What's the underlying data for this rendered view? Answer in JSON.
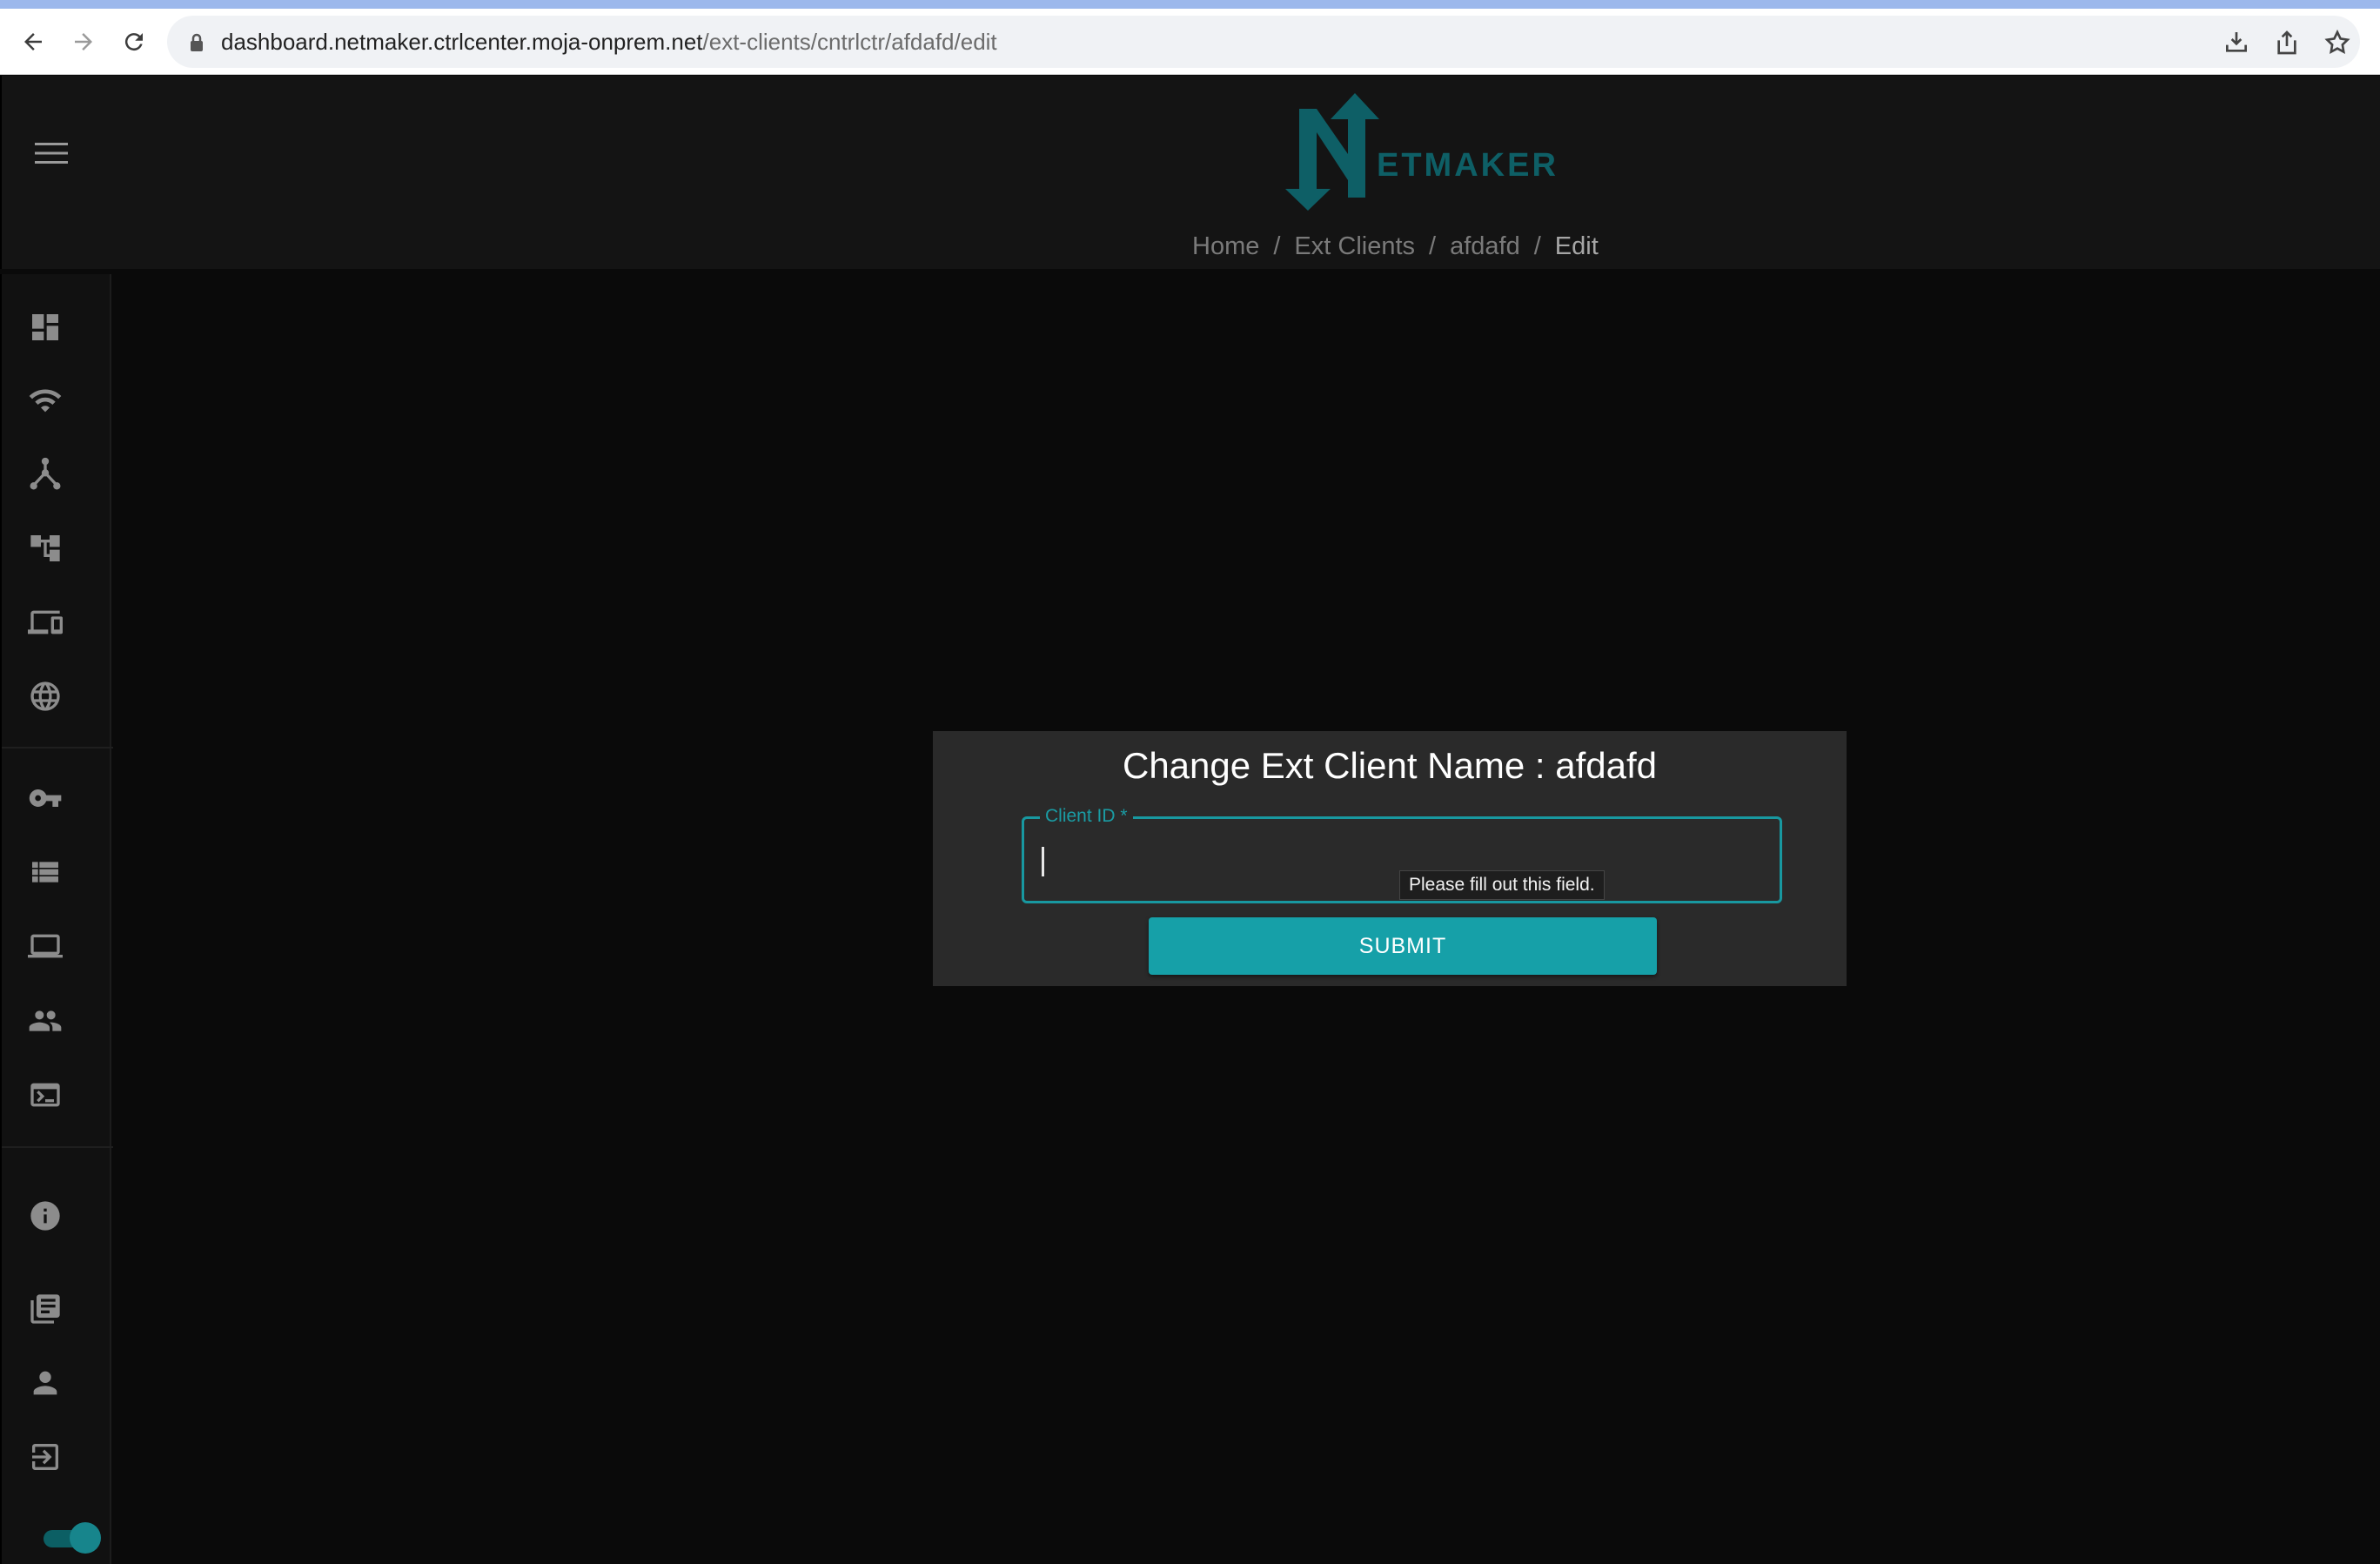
{
  "browser": {
    "url_host": "dashboard.netmaker.ctrlcenter.moja-onprem.net",
    "url_path": "/ext-clients/cntrlctr/afdafd/edit",
    "icons": [
      "back-icon",
      "forward-icon",
      "reload-icon",
      "lock-icon",
      "download-icon",
      "share-icon",
      "bookmark-star-icon"
    ]
  },
  "header": {
    "logo_text": "ETMAKER",
    "logo_letter": "N",
    "brand_color": "#0e5f66",
    "breadcrumb": {
      "items": [
        "Home",
        "Ext Clients",
        "afdafd",
        "Edit"
      ],
      "separator": "/"
    }
  },
  "sidebar": {
    "items": [
      {
        "icon": "dashboard-icon"
      },
      {
        "icon": "wifi-icon"
      },
      {
        "icon": "hub-icon"
      },
      {
        "icon": "account-tree-icon"
      },
      {
        "icon": "devices-icon"
      },
      {
        "icon": "globe-icon"
      },
      {
        "icon": "key-icon"
      },
      {
        "icon": "list-icon"
      },
      {
        "icon": "laptop-icon"
      },
      {
        "icon": "people-icon"
      },
      {
        "icon": "terminal-icon"
      },
      {
        "icon": "info-icon"
      },
      {
        "icon": "library-books-icon"
      },
      {
        "icon": "person-icon"
      },
      {
        "icon": "logout-icon"
      }
    ],
    "theme_toggle_on": true
  },
  "dialog": {
    "title": "Change Ext Client Name : afdafd",
    "field_label": "Client ID",
    "required_mark": "*",
    "field_value": "",
    "validation_tooltip": "Please fill out this field.",
    "submit_label": "SUBMIT",
    "accent_color": "#16a0a8"
  }
}
